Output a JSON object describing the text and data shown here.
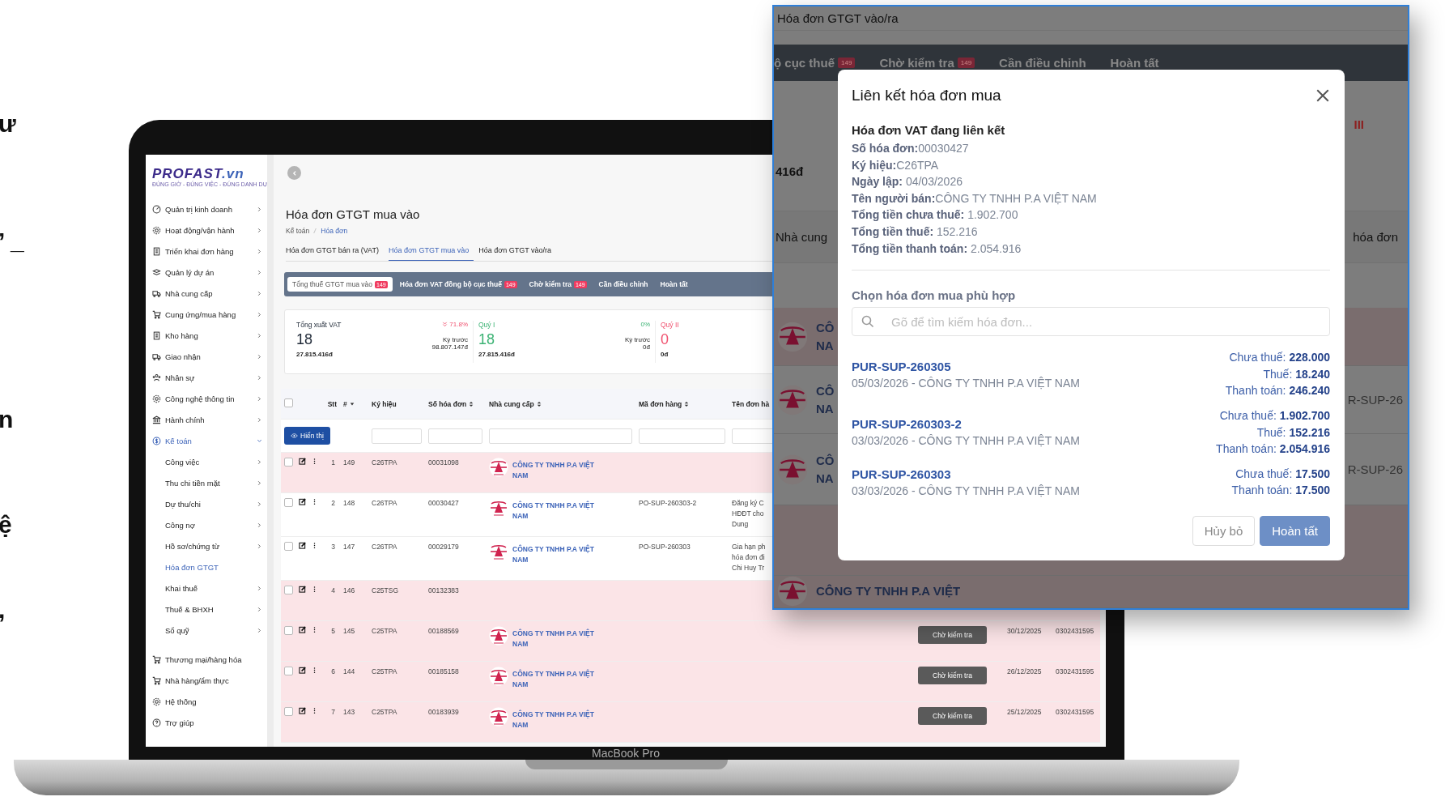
{
  "edge_text": [
    "ư",
    "’ _",
    "n",
    "ệ",
    ","
  ],
  "device_label": "MacBook Pro",
  "logo": {
    "name": "PROFAST",
    "suffix": ".vn",
    "tagline": "ĐÚNG GIỜ - ĐÚNG VIỆC - ĐÚNG DANH DỰ"
  },
  "sidebar": {
    "items": [
      {
        "label": "Quản trị kinh doanh",
        "expandable": true,
        "selected": false
      },
      {
        "label": "Hoạt động/vận hành",
        "expandable": true,
        "selected": false
      },
      {
        "label": "Triển khai đơn hàng",
        "expandable": true,
        "selected": false
      },
      {
        "label": "Quản lý dự án",
        "expandable": true,
        "selected": false
      },
      {
        "label": "Nhà cung cấp",
        "expandable": true,
        "selected": false
      },
      {
        "label": "Cung ứng/mua hàng",
        "expandable": true,
        "selected": false
      },
      {
        "label": "Kho hàng",
        "expandable": true,
        "selected": false
      },
      {
        "label": "Giao nhận",
        "expandable": true,
        "selected": false
      },
      {
        "label": "Nhân sự",
        "expandable": true,
        "selected": false
      },
      {
        "label": "Công nghệ thông tin",
        "expandable": true,
        "selected": false
      },
      {
        "label": "Hành chính",
        "expandable": true,
        "selected": false
      },
      {
        "label": "Kế toán",
        "expandable": true,
        "expanded": true,
        "selected": true,
        "children": [
          {
            "label": "Công việc",
            "expandable": true,
            "selected": false
          },
          {
            "label": "Thu chi tiền mặt",
            "expandable": true,
            "selected": false
          },
          {
            "label": "Dự thu/chi",
            "expandable": true,
            "selected": false
          },
          {
            "label": "Công nợ",
            "expandable": true,
            "selected": false
          },
          {
            "label": "Hồ sơ/chứng từ",
            "expandable": true,
            "selected": false
          },
          {
            "label": "Hóa đơn GTGT",
            "expandable": false,
            "selected": true
          },
          {
            "label": "Khai thuế",
            "expandable": true,
            "selected": false
          },
          {
            "label": "Thuế & BHXH",
            "expandable": true,
            "selected": false
          },
          {
            "label": "Sổ quỹ",
            "expandable": true,
            "selected": false
          }
        ]
      },
      {
        "label": "Thương mại/hàng hóa",
        "expandable": false,
        "selected": false
      },
      {
        "label": "Nhà hàng/ẩm thực",
        "expandable": false,
        "selected": false
      },
      {
        "label": "Hệ thống",
        "expandable": false,
        "selected": false
      },
      {
        "label": "Trợ giúp",
        "expandable": false,
        "selected": false
      }
    ]
  },
  "page": {
    "title": "Hóa đơn GTGT mua vào",
    "breadcrumb": [
      {
        "label": "Kế toán",
        "link": false
      },
      {
        "label": "Hóa đơn",
        "link": true
      }
    ]
  },
  "tabs": [
    {
      "label": "Hóa đơn GTGT bán ra (VAT)",
      "selected": false
    },
    {
      "label": "Hóa đơn GTGT mua vào",
      "selected": true
    },
    {
      "label": "Hóa đơn GTGT vào/ra",
      "selected": false
    }
  ],
  "subtabs": [
    {
      "label": "Tổng thuế GTGT mua vào",
      "badge": "149",
      "selected": true
    },
    {
      "label": "Hóa đơn VAT đồng bộ cục thuế",
      "badge": "149",
      "selected": false
    },
    {
      "label": "Chờ kiểm tra",
      "badge": "149",
      "selected": false
    },
    {
      "label": "Cần điều chỉnh",
      "selected": false
    },
    {
      "label": "Hoàn tất",
      "selected": false
    }
  ],
  "stats": [
    {
      "label": "Tổng xuất VAT",
      "color": "#1f2937",
      "count": "18",
      "amount": "27.815.416đ",
      "kind": "decrease",
      "change": "71.8%",
      "prev_label": "Kỳ trước",
      "prev_amount": "98.807.147đ"
    },
    {
      "label": "Quý I",
      "color": "#3bb273",
      "count": "18",
      "amount": "27.815.416đ",
      "kind": "steady",
      "change": "0%",
      "prev_label": "Kỳ trước",
      "prev_amount": "0đ"
    },
    {
      "label": "Quý II",
      "color": "#f0506e",
      "count": "0",
      "amount": "0đ"
    }
  ],
  "table": {
    "select_all": {
      "checked": false
    },
    "columns": [
      {
        "label": "Stt",
        "kind": "plain"
      },
      {
        "label": "#",
        "kind": "sorted"
      },
      {
        "label": "Ký hiệu",
        "kind": "plain"
      },
      {
        "label": "Số hóa đơn",
        "kind": "sortable"
      },
      {
        "label": "Nhà cung cấp",
        "kind": "sortable"
      },
      {
        "label": "Mã đơn hàng",
        "kind": "sortable"
      },
      {
        "label": "Tên đơn hà",
        "kind": "plain"
      }
    ],
    "filter_button": "Hiển thị",
    "rows": [
      {
        "checked": false,
        "highlighted": true,
        "stt": "1",
        "num": "149",
        "symbol": "C26TPA",
        "invoice_no": "00031098",
        "supplier": "CÔNG TY TNHH P.A VIỆT NAM"
      },
      {
        "checked": false,
        "highlighted": false,
        "stt": "2",
        "num": "148",
        "symbol": "C26TPA",
        "invoice_no": "00030427",
        "supplier": "CÔNG TY TNHH P.A VIỆT NAM",
        "order_code": "PO-SUP-260303-2",
        "order_name": "Đăng ký C\nHĐĐT cho\nDung"
      },
      {
        "checked": false,
        "highlighted": false,
        "stt": "3",
        "num": "147",
        "symbol": "C26TPA",
        "invoice_no": "00029179",
        "supplier": "CÔNG TY TNHH P.A VIỆT NAM",
        "order_code": "PO-SUP-260303",
        "order_name": "Gia hạn ph\nhóa đơn đi\nChi Huy Tr"
      },
      {
        "checked": false,
        "highlighted": true,
        "stt": "4",
        "num": "146",
        "symbol": "C25TSG",
        "invoice_no": "00132383"
      },
      {
        "checked": false,
        "highlighted": true,
        "stt": "5",
        "num": "145",
        "symbol": "C25TPA",
        "invoice_no": "00188569",
        "supplier": "CÔNG TY TNHH P.A VIỆT NAM",
        "status": "Chờ kiểm tra",
        "date": "30/12/2025",
        "tax_code": "0302431595"
      },
      {
        "checked": false,
        "highlighted": true,
        "stt": "6",
        "num": "144",
        "symbol": "C25TPA",
        "invoice_no": "00185158",
        "supplier": "CÔNG TY TNHH P.A VIỆT NAM",
        "status": "Chờ kiểm tra",
        "date": "26/12/2025",
        "tax_code": "0302431595"
      },
      {
        "checked": false,
        "highlighted": true,
        "stt": "7",
        "num": "143",
        "symbol": "C25TPA",
        "invoice_no": "00183939",
        "supplier": "CÔNG TY TNHH P.A VIỆT NAM",
        "status": "Chờ kiểm tra",
        "date": "25/12/2025",
        "tax_code": "0302431595"
      }
    ]
  },
  "popup_window": {
    "background": {
      "title": "Hóa đơn GTGT vào/ra",
      "tabs": [
        {
          "label": "ộ cục thuế",
          "badge": "149"
        },
        {
          "label": "Chờ kiểm tra",
          "badge": "149"
        },
        {
          "label": "Cần điều chỉnh"
        },
        {
          "label": "Hoàn tất"
        }
      ],
      "quarter_label": "III",
      "amount": "416đ",
      "left_heading": "Nhà cung",
      "right_heading": "hóa đơn",
      "rows": [
        {
          "highlighted": true,
          "name": "CÔ\nNA"
        },
        {
          "highlighted": false,
          "name": "CÔ\nNA",
          "code": "R-SUP-26"
        },
        {
          "highlighted": false,
          "name": "CÔ\nNA",
          "code": "R-SUP-26"
        },
        {
          "highlighted": true
        },
        {
          "highlighted": true,
          "name": "CÔNG TY TNHH P.A VIỆT"
        }
      ]
    },
    "modal": {
      "title": "Liên kết hóa đơn mua",
      "section_title": "Hóa đơn VAT đang liên kết",
      "fields": [
        "**Số hóa đơn:**00030427",
        "**Ký hiệu:**C26TPA",
        "**Ngày lập:** 04/03/2026",
        "**Tên người bán:**CÔNG TY TNHH P.A VIỆT NAM",
        "**Tổng tiền chưa thuế:** 1.902.700",
        "**Tổng tiền thuế:** 152.216",
        "**Tổng tiền thanh toán:** 2.054.916"
      ],
      "choose_label": "Chọn hóa đơn mua phù hợp",
      "search": {
        "placeholder": "Gõ để tìm kiếm hóa đơn..."
      },
      "candidates": [
        {
          "code": "PUR-SUP-260305",
          "subtitle": "05/03/2026 - CÔNG TY TNHH P.A VIỆT NAM",
          "amounts": [
            "Chưa thuế: **228.000**",
            "Thuế: **18.240**",
            "Thanh toán: **246.240**"
          ]
        },
        {
          "code": "PUR-SUP-260303-2",
          "subtitle": "03/03/2026 - CÔNG TY TNHH P.A VIỆT NAM",
          "amounts": [
            "Chưa thuế: **1.902.700**",
            "Thuế: **152.216**",
            "Thanh toán: **2.054.916**"
          ]
        },
        {
          "code": "PUR-SUP-260303",
          "subtitle": "03/03/2026 - CÔNG TY TNHH P.A VIỆT NAM",
          "amounts": [
            "Chưa thuế: **17.500**",
            "Thanh toán: **17.500**"
          ]
        }
      ],
      "buttons": [
        {
          "label": "Hủy bỏ",
          "kind": "secondary"
        },
        {
          "label": "Hoàn tất",
          "kind": "primary"
        }
      ]
    }
  }
}
